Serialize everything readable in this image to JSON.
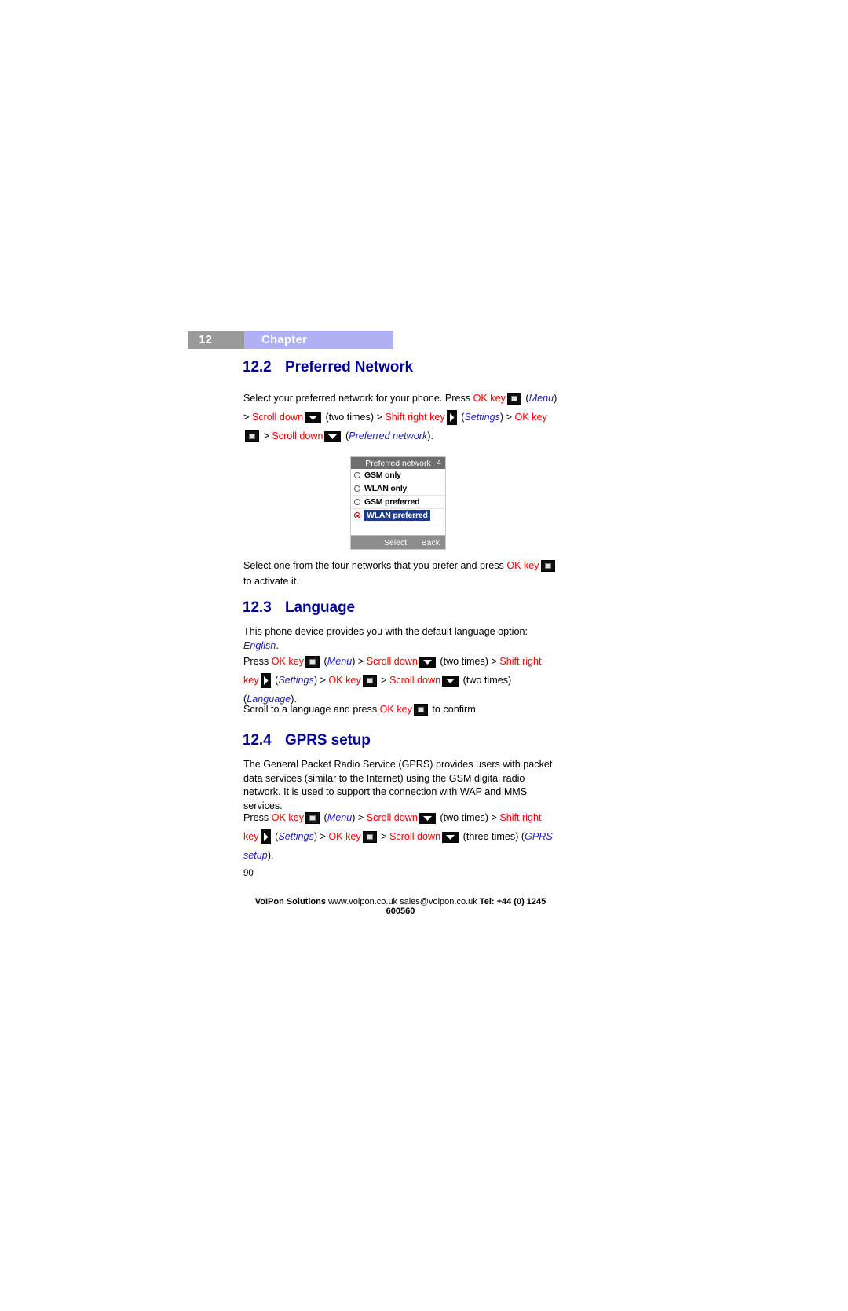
{
  "chapter": {
    "number": "12",
    "label": "Chapter"
  },
  "sections": {
    "preferred_network": {
      "number": "12.2",
      "title": "Preferred Network",
      "intro_prefix": "Select your preferred network for your phone. Press ",
      "ok_key": "OK key",
      "menu": "Menu",
      "scroll_down": "Scroll down",
      "two_times": "(two times)",
      "shift_right_key": "Shift right key",
      "settings": "Settings",
      "preferred_network_italic": "Preferred network",
      "after_text": "Select one from the four networks that you prefer and press ",
      "after_text_tail": " to activate it."
    },
    "language": {
      "number": "12.3",
      "title": "Language",
      "body": "This phone device provides you with the default language option: ",
      "body_italic": "English",
      "press": "Press ",
      "ok_key": "OK key",
      "menu": "Menu",
      "scroll_down": "Scroll down",
      "two_times": "(two times)",
      "shift_right_key": "Shift right key",
      "settings": "Settings",
      "language_italic": "Language",
      "confirm_prefix": "Scroll to a language and press ",
      "confirm_suffix": " to confirm."
    },
    "gprs": {
      "number": "12.4",
      "title": "GPRS setup",
      "body": "The General Packet Radio Service (GPRS) provides users with packet data services (similar to the Internet) using the GSM digital radio network. It is used to support the connection with WAP and MMS services.",
      "press": "Press ",
      "ok_key": "OK key",
      "menu": "Menu",
      "scroll_down": "Scroll down",
      "two_times": "(two times)",
      "three_times": "(three times)",
      "shift_right_key": "Shift right key",
      "settings": "Settings",
      "gprs_setup_italic": "GPRS setup"
    }
  },
  "phone_screen": {
    "title": "Preferred network",
    "title_count": "4",
    "options": [
      {
        "label": "GSM only",
        "selected": false
      },
      {
        "label": "WLAN only",
        "selected": false
      },
      {
        "label": "GSM preferred",
        "selected": false
      },
      {
        "label": "WLAN preferred",
        "selected": true
      }
    ],
    "softkey_left": "Select",
    "softkey_right": "Back"
  },
  "footer": {
    "page_number": "90",
    "company": "VoIPon Solutions",
    "website": "www.voipon.co.uk",
    "email": "sales@voipon.co.uk",
    "telephone": "Tel: +44 (0) 1245 600560"
  },
  "colors": {
    "heading": "#00009f",
    "action": "#ff0000",
    "menu_label": "#2222bb",
    "chapter_bar": "#b0b0f5",
    "chapter_num_bg": "#9a9a9a"
  }
}
